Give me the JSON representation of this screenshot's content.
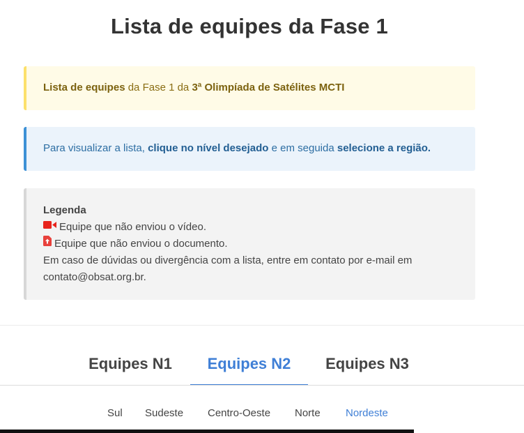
{
  "page": {
    "title": "Lista de equipes da Fase 1"
  },
  "notice": {
    "bold1": "Lista de equipes",
    "text1": " da Fase 1 da ",
    "bold2": "3ª Olimpíada de Satélites MCTI"
  },
  "info": {
    "text1": "Para visualizar a lista, ",
    "bold1": "clique no nível desejado",
    "text2": " e em seguida ",
    "bold2": "selecione a região."
  },
  "legend": {
    "heading": "Legenda",
    "video_item": "Equipe que não enviou o vídeo.",
    "document_item": "Equipe que não enviou o documento.",
    "contact_line1": "Em caso de dúvidas ou divergência com a lista, entre em contato por e-mail em",
    "contact_line2": "contato@obsat.org.br.",
    "video_icon": "video-camera-icon",
    "document_icon": "file-upload-icon",
    "icon_colors": {
      "video": "#e8231c",
      "document": "#e8413c"
    }
  },
  "tabs": [
    {
      "label": "Equipes N1",
      "active": false
    },
    {
      "label": "Equipes N2",
      "active": true
    },
    {
      "label": "Equipes N3",
      "active": false
    }
  ],
  "regions": [
    {
      "label": "Sul",
      "active": false
    },
    {
      "label": "Sudeste",
      "active": false
    },
    {
      "label": "Centro-Oeste",
      "active": false
    },
    {
      "label": "Norte",
      "active": false
    },
    {
      "label": "Nordeste",
      "active": true
    }
  ],
  "colors": {
    "accent": "#3f7fd6",
    "warning_border": "#fce06b",
    "info_border": "#3d91d6"
  }
}
